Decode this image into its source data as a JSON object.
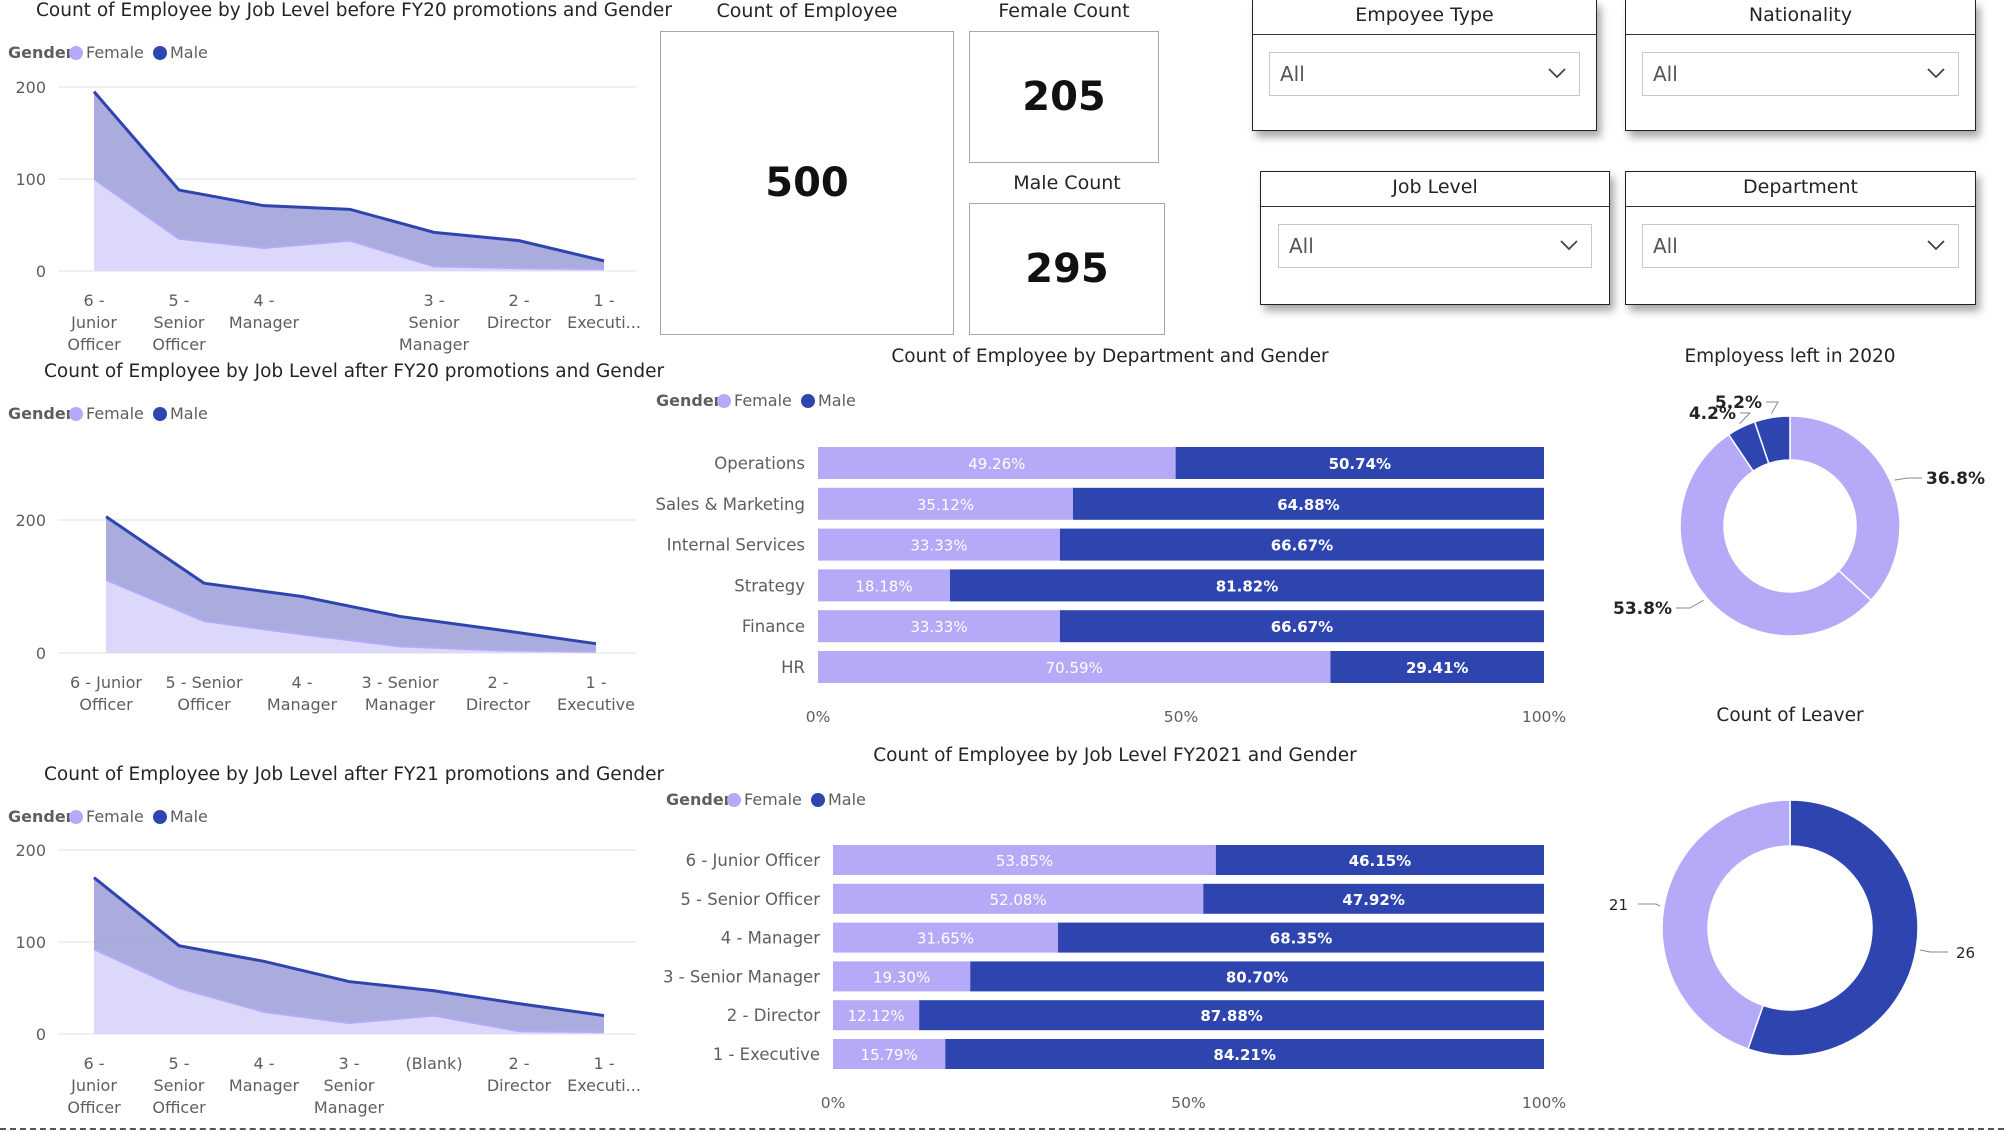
{
  "colors": {
    "female": "#b4aaf7",
    "male": "#2e45b0",
    "female_area": "#dcd8fb",
    "male_area": "#a4a8db",
    "grid": "#e1e1e1",
    "axis_text": "#605e5c"
  },
  "legend": {
    "title": "Gender",
    "female": "Female",
    "male": "Male"
  },
  "cards": {
    "count": {
      "label": "Count of Employee",
      "value": "500"
    },
    "female": {
      "label": "Female Count",
      "value": "205"
    },
    "male": {
      "label": "Male Count",
      "value": "295"
    }
  },
  "slicers": {
    "employee_type": {
      "title": "Empoyee Type",
      "value": "All",
      "icon": "chevron-down-icon"
    },
    "nationality": {
      "title": "Nationality",
      "value": "All",
      "icon": "chevron-down-icon"
    },
    "job_level": {
      "title": "Job Level",
      "value": "All",
      "icon": "chevron-down-icon"
    },
    "department": {
      "title": "Department",
      "value": "All",
      "icon": "chevron-down-icon"
    }
  },
  "chart_data": [
    {
      "id": "before_fy20",
      "type": "area",
      "stacked": true,
      "title": "Count of Employee by Job Level before FY20 promotions and Gender",
      "categories": [
        "6 - Junior Officer",
        "5 - Senior Officer",
        "4 - Manager",
        "",
        "3 - Senior Manager",
        "2 - Director",
        "1 - Executi..."
      ],
      "series": [
        {
          "name": "Female",
          "values": [
            100,
            35,
            25,
            33,
            5,
            3,
            2
          ]
        },
        {
          "name": "Male",
          "values": [
            95,
            53,
            46,
            34,
            37,
            30,
            9
          ]
        }
      ],
      "yticks": [
        0,
        100,
        200
      ],
      "ylim": [
        0,
        200
      ],
      "legend": "top-left",
      "grid": true
    },
    {
      "id": "after_fy20",
      "type": "area",
      "stacked": true,
      "title": "Count of Employee by Job Level after FY20 promotions and Gender",
      "categories": [
        "6 - Junior Officer",
        "5 - Senior Officer",
        "4 - Manager",
        "3 - Senior Manager",
        "2 - Director",
        "1 - Executive"
      ],
      "series": [
        {
          "name": "Female",
          "values": [
            110,
            48,
            28,
            10,
            4,
            2
          ]
        },
        {
          "name": "Male",
          "values": [
            95,
            57,
            57,
            45,
            31,
            12
          ]
        }
      ],
      "yticks": [
        0,
        200
      ],
      "ylim": [
        0,
        200
      ],
      "legend": "top-left",
      "grid": true
    },
    {
      "id": "after_fy21",
      "type": "area",
      "stacked": true,
      "title": "Count of Employee by Job Level after FY21 promotions and Gender",
      "categories": [
        "6 - Junior Officer",
        "5 - Senior Officer",
        "4 - Manager",
        "3 - Senior Manager",
        "(Blank)",
        "2 - Director",
        "1 - Executi..."
      ],
      "series": [
        {
          "name": "Female",
          "values": [
            92,
            50,
            24,
            12,
            20,
            3,
            2
          ]
        },
        {
          "name": "Male",
          "values": [
            78,
            46,
            55,
            45,
            27,
            30,
            18
          ]
        }
      ],
      "yticks": [
        0,
        100,
        200
      ],
      "ylim": [
        0,
        200
      ],
      "legend": "top-left",
      "grid": true
    },
    {
      "id": "dept_gender",
      "type": "bar",
      "stacked_percent": true,
      "orientation": "horizontal",
      "title": "Count of Employee by Department and Gender",
      "categories": [
        "Operations",
        "Sales & Marketing",
        "Internal Services",
        "Strategy",
        "Finance",
        "HR"
      ],
      "series": [
        {
          "name": "Female",
          "values": [
            49.26,
            35.12,
            33.33,
            18.18,
            33.33,
            70.59
          ],
          "labels": [
            "49.26%",
            "35.12%",
            "33.33%",
            "18.18%",
            "33.33%",
            "70.59%"
          ]
        },
        {
          "name": "Male",
          "values": [
            50.74,
            64.88,
            66.67,
            81.82,
            66.67,
            29.41
          ],
          "labels": [
            "50.74%",
            "64.88%",
            "66.67%",
            "81.82%",
            "66.67%",
            "29.41%"
          ]
        }
      ],
      "xticks": [
        "0%",
        "50%",
        "100%"
      ],
      "legend": "top-left"
    },
    {
      "id": "level_fy2021",
      "type": "bar",
      "stacked_percent": true,
      "orientation": "horizontal",
      "title": "Count of Employee by Job Level FY2021 and Gender",
      "categories": [
        "6 - Junior Officer",
        "5 - Senior Officer",
        "4 - Manager",
        "3 - Senior Manager",
        "2 - Director",
        "1 - Executive"
      ],
      "series": [
        {
          "name": "Female",
          "values": [
            53.85,
            52.08,
            31.65,
            19.3,
            12.12,
            15.79
          ],
          "labels": [
            "53.85%",
            "52.08%",
            "31.65%",
            "19.30%",
            "12.12%",
            "15.79%"
          ]
        },
        {
          "name": "Male",
          "values": [
            46.15,
            47.92,
            68.35,
            80.7,
            87.88,
            84.21
          ],
          "labels": [
            "46.15%",
            "47.92%",
            "68.35%",
            "80.70%",
            "87.88%",
            "84.21%"
          ]
        }
      ],
      "xticks": [
        "0%",
        "50%",
        "100%"
      ],
      "legend": "top-left"
    },
    {
      "id": "left_2020",
      "type": "pie",
      "donut": true,
      "title": "Employess left in 2020",
      "slices": [
        {
          "value": 36.8,
          "label": "36.8%",
          "color": "#b4aaf7"
        },
        {
          "value": 53.8,
          "label": "53.8%",
          "color": "#b4aaf7"
        },
        {
          "value": 4.2,
          "label": "4.2%",
          "color": "#2e45b0"
        },
        {
          "value": 5.2,
          "label": "5.2%",
          "color": "#2e45b0"
        }
      ]
    },
    {
      "id": "count_leaver",
      "type": "pie",
      "donut": true,
      "title": "Count of Leaver",
      "slices": [
        {
          "value": 26,
          "label": "26",
          "color": "#2e45b0"
        },
        {
          "value": 21,
          "label": "21",
          "color": "#b4aaf7"
        }
      ]
    }
  ]
}
